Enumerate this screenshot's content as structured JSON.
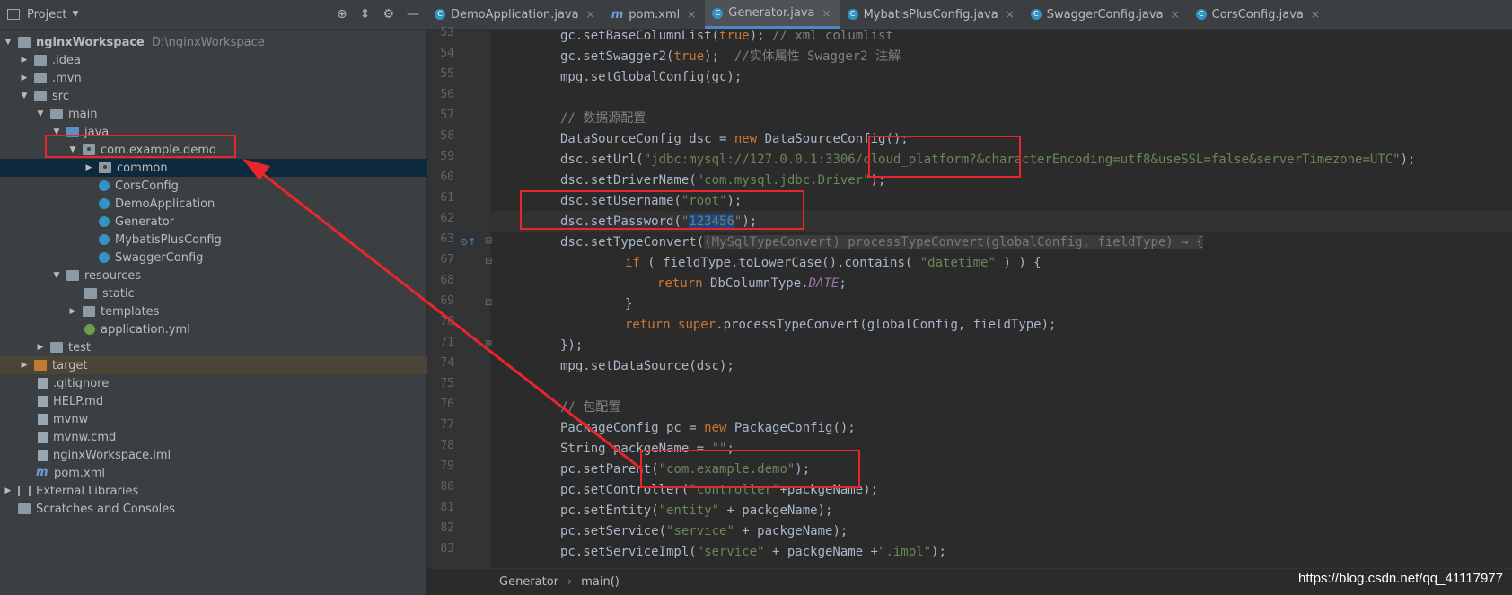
{
  "project_panel": {
    "title": "Project"
  },
  "tabs": [
    {
      "label": "DemoApplication.java",
      "icon": "class-icon"
    },
    {
      "label": "pom.xml",
      "icon": "maven-icon"
    },
    {
      "label": "Generator.java",
      "icon": "class-icon",
      "active": true
    },
    {
      "label": "MybatisPlusConfig.java",
      "icon": "class-icon"
    },
    {
      "label": "SwaggerConfig.java",
      "icon": "class-icon"
    },
    {
      "label": "CorsConfig.java",
      "icon": "class-icon"
    }
  ],
  "tree": {
    "root": {
      "label": "nginxWorkspace",
      "path": "D:\\nginxWorkspace"
    },
    "items": [
      {
        "label": ".idea"
      },
      {
        "label": ".mvn"
      },
      {
        "label": "src"
      },
      {
        "label": "main"
      },
      {
        "label": "java"
      },
      {
        "label": "com.example.demo"
      },
      {
        "label": "common"
      },
      {
        "label": "CorsConfig"
      },
      {
        "label": "DemoApplication"
      },
      {
        "label": "Generator"
      },
      {
        "label": "MybatisPlusConfig"
      },
      {
        "label": "SwaggerConfig"
      },
      {
        "label": "resources"
      },
      {
        "label": "static"
      },
      {
        "label": "templates"
      },
      {
        "label": "application.yml"
      },
      {
        "label": "test"
      },
      {
        "label": "target"
      },
      {
        "label": ".gitignore"
      },
      {
        "label": "HELP.md"
      },
      {
        "label": "mvnw"
      },
      {
        "label": "mvnw.cmd"
      },
      {
        "label": "nginxWorkspace.iml"
      },
      {
        "label": "pom.xml"
      },
      {
        "label": "External Libraries"
      },
      {
        "label": "Scratches and Consoles"
      }
    ]
  },
  "line_numbers": [
    "53",
    "54",
    "55",
    "56",
    "57",
    "58",
    "59",
    "60",
    "61",
    "62",
    "63",
    "67",
    "68",
    "69",
    "70",
    "71",
    "74",
    "75",
    "76",
    "77",
    "78",
    "79",
    "80",
    "81",
    "82",
    "83"
  ],
  "code": {
    "l53": {
      "a": "gc.setBaseColumnList(",
      "b": "true",
      "c": "); ",
      "d": "// xml columlist"
    },
    "l54": {
      "a": "gc.setSwagger2(",
      "b": "true",
      "c": ");  ",
      "d": "//实体属性 Swagger2 注解"
    },
    "l55": "mpg.setGlobalConfig(gc);",
    "l57": "// 数据源配置",
    "l58": {
      "a": "DataSourceConfig dsc = ",
      "b": "new ",
      "c": "DataSourceConfig();"
    },
    "l59": {
      "a": "dsc.setUrl(",
      "b": "\"jdbc:mysql://127.0.0.1:3306/cloud_platform?&characterEncoding=utf8&useSSL=false&serverTimezone=UTC\"",
      "c": ");"
    },
    "l60": {
      "a": "dsc.setDriverName(",
      "b": "\"com.mysql.jdbc.Driver\"",
      "c": ");"
    },
    "l61": {
      "a": "dsc.setUsername(",
      "b": "\"root\"",
      "c": ");"
    },
    "l62": {
      "a": "dsc.setPassword(",
      "q1": "\"",
      "b": "123456",
      "q2": "\"",
      "c": ");"
    },
    "l63": {
      "a": "dsc.setTypeConvert(",
      "h": "(MySqlTypeConvert) processTypeConvert(globalConfig, fieldType) → {"
    },
    "l67": {
      "a": "if ",
      "b": "( fieldType.toLowerCase().contains( ",
      "c": "\"datetime\"",
      "d": " ) ) {"
    },
    "l68": {
      "a": "return ",
      "b": "DbColumnType.",
      "c": "DATE",
      "d": ";"
    },
    "l69": "}",
    "l70": {
      "a": "return ",
      "b": "super",
      "c": ".processTypeConvert(globalConfig, fieldType);"
    },
    "l71": "});",
    "l74": "mpg.setDataSource(dsc);",
    "l76": "// 包配置",
    "l77": {
      "a": "PackageConfig pc = ",
      "b": "new ",
      "c": "PackageConfig();"
    },
    "l78": {
      "a": "String packgeName = ",
      "b": "\"\"",
      "c": ";"
    },
    "l79": {
      "a": "pc.setParent(",
      "b": "\"com.example.demo\"",
      "c": ");"
    },
    "l80": {
      "a": "pc.setController(",
      "b": "\"controller\"",
      "c": "+packgeName);"
    },
    "l81": {
      "a": "pc.setEntity(",
      "b": "\"entity\"",
      "c": " + packgeName);"
    },
    "l82": {
      "a": "pc.setService(",
      "b": "\"service\"",
      "c": " + packgeName);"
    },
    "l83": {
      "a": "pc.setServiceImpl(",
      "b": "\"service\"",
      "c": " + packgeName +",
      "d": "\".impl\"",
      "e": ");"
    }
  },
  "breadcrumb": [
    "Generator",
    "main()"
  ],
  "watermark": "https://blog.csdn.net/qq_41117977",
  "colors": {
    "annotation": "#e8262b",
    "keyword": "#cc7832",
    "string": "#6a8759",
    "comment": "#808080"
  }
}
